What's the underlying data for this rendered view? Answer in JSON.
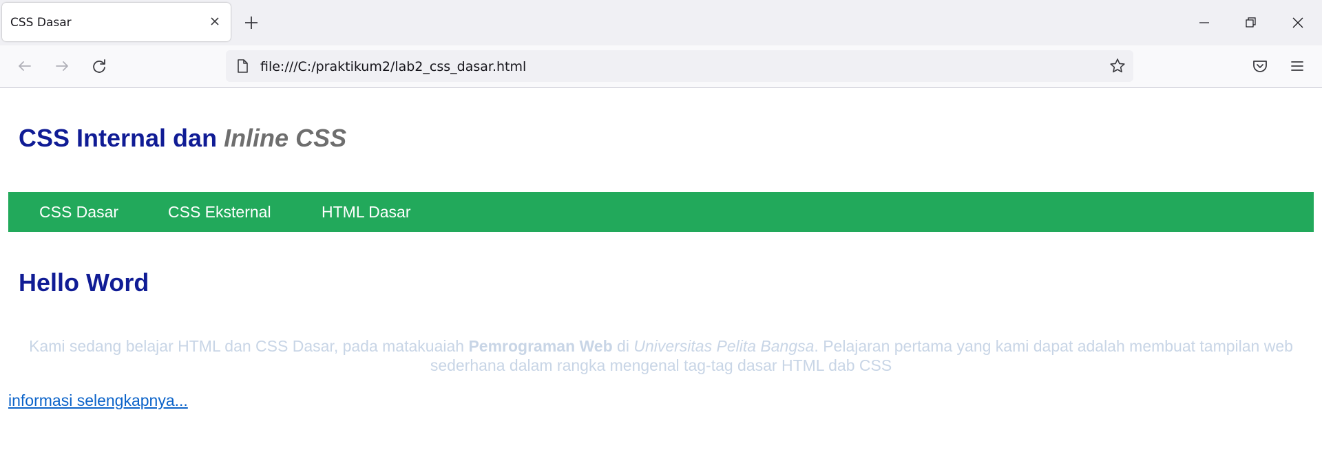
{
  "browser": {
    "tab": {
      "title": "CSS Dasar"
    },
    "url": "file:///C:/praktikum2/lab2_css_dasar.html",
    "icons": {
      "tab_close": "close-icon",
      "new_tab": "plus-icon",
      "back": "arrow-left-icon",
      "forward": "arrow-right-icon",
      "reload": "reload-icon",
      "page": "page-icon",
      "bookmark": "star-icon",
      "pocket": "pocket-icon",
      "menu": "hamburger-menu-icon",
      "minimize": "minimize-icon",
      "restore": "restore-icon",
      "close_window": "close-window-icon"
    }
  },
  "page": {
    "header": {
      "title_plain": "CSS Internal dan ",
      "title_italic": "Inline CSS"
    },
    "nav": {
      "items": [
        {
          "label": "CSS Dasar"
        },
        {
          "label": "CSS Eksternal"
        },
        {
          "label": "HTML Dasar"
        }
      ]
    },
    "section": {
      "heading": "Hello Word",
      "paragraph": {
        "part1": "Kami sedang belajar HTML dan CSS Dasar, pada matakuaiah ",
        "bold": "Pemrograman Web",
        "part2": " di ",
        "italic": "Universitas Pelita Bangsa",
        "part3": ". Pelajaran pertama yang kami dapat adalah membuat tampilan web sederhana dalam rangka mengenal tag-tag dasar HTML dab CSS"
      }
    },
    "link": {
      "label": "informasi selengkapnya..."
    }
  },
  "colors": {
    "heading": "#101c95",
    "heading_italic": "#6e6e6e",
    "nav_background": "#22a95b",
    "nav_text": "#ffffff",
    "paragraph": "#c8d5e6",
    "link": "#0b63c9"
  }
}
